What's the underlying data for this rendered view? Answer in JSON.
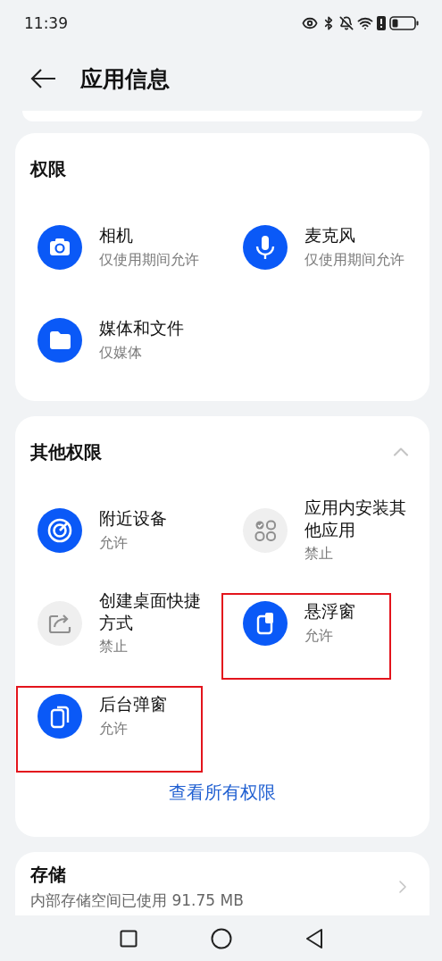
{
  "status_bar": {
    "time": "11:39"
  },
  "header": {
    "title": "应用信息"
  },
  "permissions": {
    "title": "权限",
    "items": [
      {
        "name": "相机",
        "status": "仅使用期间允许",
        "allowed": true,
        "highlighted": false
      },
      {
        "name": "麦克风",
        "status": "仅使用期间允许",
        "allowed": true,
        "highlighted": false
      },
      {
        "name": "媒体和文件",
        "status": "仅媒体",
        "allowed": true,
        "highlighted": false
      }
    ]
  },
  "other_permissions": {
    "title": "其他权限",
    "expanded": true,
    "items": [
      {
        "name": "附近设备",
        "status": "允许",
        "allowed": true,
        "highlighted": false
      },
      {
        "name": "应用内安装其他应用",
        "status": "禁止",
        "allowed": false,
        "highlighted": false
      },
      {
        "name": "创建桌面快捷方式",
        "status": "禁止",
        "allowed": false,
        "highlighted": false
      },
      {
        "name": "悬浮窗",
        "status": "允许",
        "allowed": true,
        "highlighted": true
      },
      {
        "name": "后台弹窗",
        "status": "允许",
        "allowed": true,
        "highlighted": true
      }
    ],
    "link": "查看所有权限"
  },
  "storage": {
    "title": "存储",
    "subtitle": "内部存储空间已使用 91.75 MB"
  }
}
